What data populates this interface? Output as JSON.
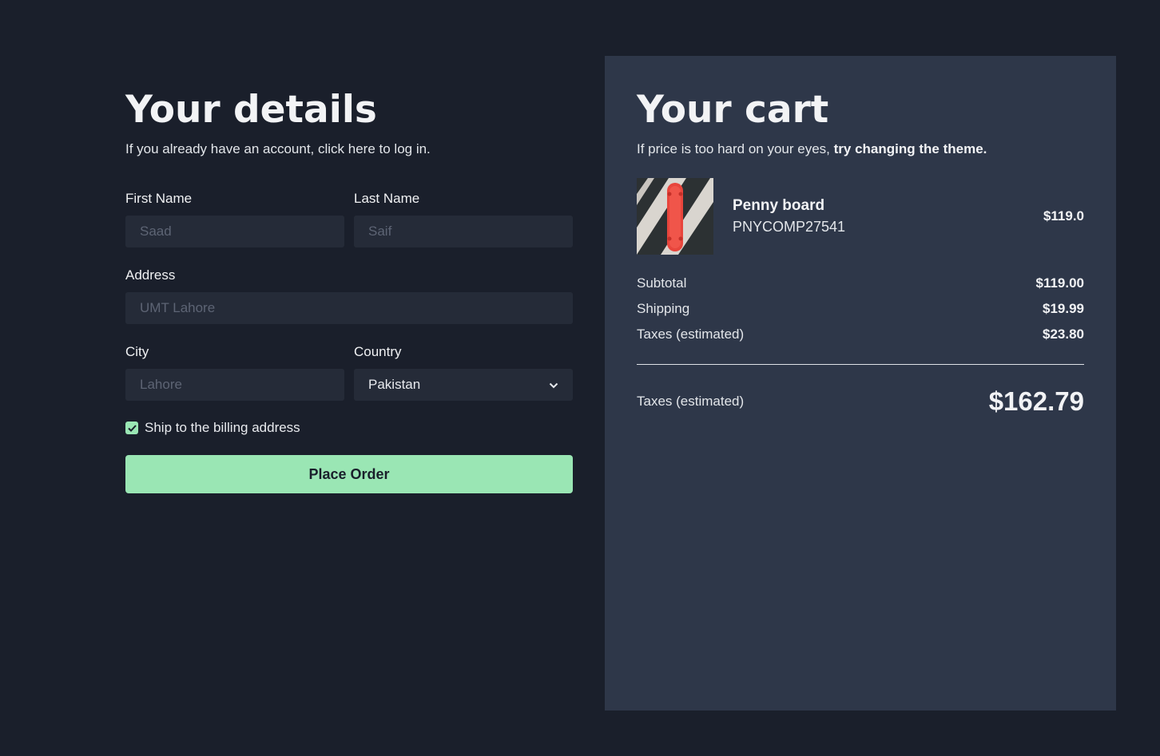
{
  "details": {
    "title": "Your details",
    "subtitle": "If you already have an account, click here to log in.",
    "first_name": {
      "label": "First Name",
      "placeholder": "Saad"
    },
    "last_name": {
      "label": "Last Name",
      "placeholder": "Saif"
    },
    "address": {
      "label": "Address",
      "placeholder": "UMT Lahore"
    },
    "city": {
      "label": "City",
      "placeholder": "Lahore"
    },
    "country": {
      "label": "Country",
      "value": "Pakistan"
    },
    "ship_checkbox": {
      "label": "Ship to the billing address",
      "checked": true
    },
    "submit_label": "Place Order"
  },
  "cart": {
    "title": "Your cart",
    "subtitle_prefix": "If price is too hard on your eyes, ",
    "subtitle_link": "try changing the theme.",
    "item": {
      "name": "Penny board",
      "sku": "PNYCOMP27541",
      "price": "$119.0",
      "image_icon": "skateboard-image"
    },
    "subtotal": {
      "label": "Subtotal",
      "value": "$119.00"
    },
    "shipping": {
      "label": "Shipping",
      "value": "$19.99"
    },
    "taxes": {
      "label": "Taxes (estimated)",
      "value": "$23.80"
    },
    "total": {
      "label": "Taxes (estimated)",
      "value": "$162.79"
    }
  },
  "colors": {
    "background": "#1a1f2b",
    "panel": "#2e3749",
    "accent": "#9ae6b4",
    "input": "#252b38"
  }
}
